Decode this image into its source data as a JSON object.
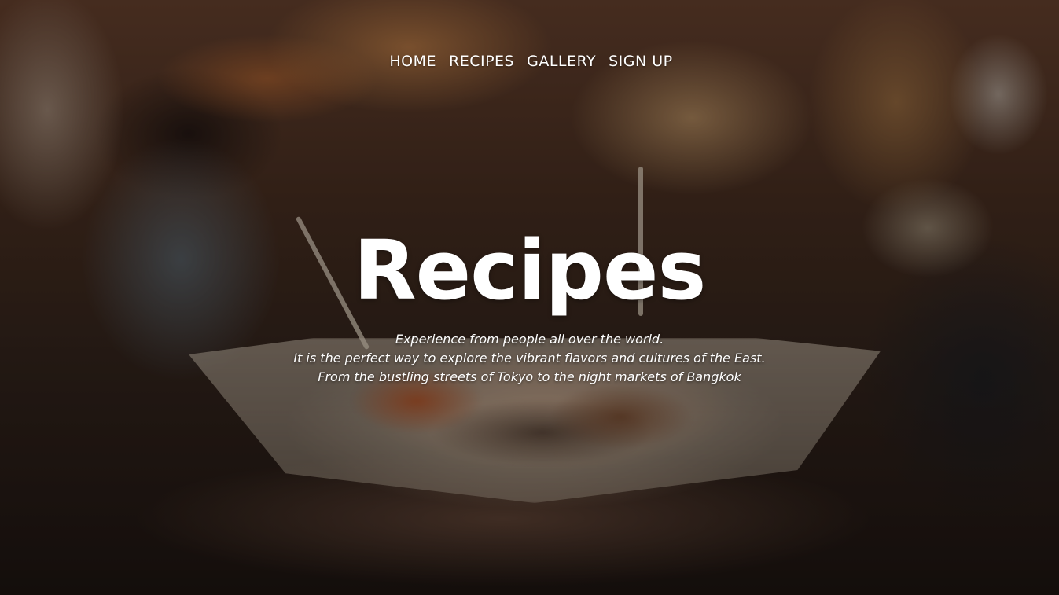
{
  "nav": {
    "items": [
      {
        "label": "HOME"
      },
      {
        "label": "RECIPES"
      },
      {
        "label": "GALLERY"
      },
      {
        "label": "SIGN UP"
      }
    ]
  },
  "hero": {
    "title": "Recipes",
    "subtitle_lines": [
      "Experience from people all over the world.",
      "It is the perfect way to explore the vibrant flavors and cultures of the East.",
      "From the bustling streets of Tokyo to the night markets of Bangkok"
    ],
    "background_image": "street-food-night-market-photo"
  },
  "colors": {
    "text": "#ffffff",
    "overlay": "rgba(0,0,0,0.35)"
  }
}
